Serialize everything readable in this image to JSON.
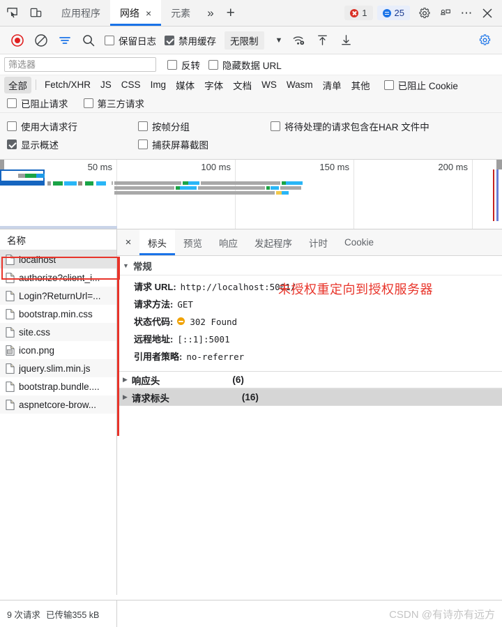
{
  "tabbar": {
    "icons": [
      {
        "name": "inspect-element-icon"
      },
      {
        "name": "device-toolbar-icon"
      }
    ],
    "tabs": [
      {
        "label": "应用程序",
        "active": false,
        "closable": false
      },
      {
        "label": "网络",
        "active": true,
        "closable": true,
        "close_label": "×"
      },
      {
        "label": "元素",
        "active": false,
        "closable": false
      }
    ],
    "more_tabs_label": "»",
    "new_tab_label": "+",
    "error_badge": "1",
    "message_badge": "25",
    "right_icons": [
      {
        "name": "settings-gear-icon"
      },
      {
        "name": "dock-position-icon"
      },
      {
        "name": "more-options-icon",
        "label": "⋯"
      },
      {
        "name": "close-devtools-icon",
        "label": "×"
      }
    ]
  },
  "net_toolbar": {
    "record_tooltip": "record",
    "clear_tooltip": "clear",
    "filter_tooltip": "filter",
    "search_tooltip": "search",
    "preserve_log_label": "保留日志",
    "preserve_log_checked": false,
    "disable_cache_label": "禁用缓存",
    "disable_cache_checked": true,
    "throttle_value": "无限制",
    "caret": "▼",
    "settings_icon": "network-settings-gear-icon"
  },
  "filter": {
    "placeholder": "筛选器",
    "value": "",
    "invert_label": "反转",
    "invert_checked": false,
    "hide_data_urls_label": "隐藏数据 URL",
    "hide_data_urls_checked": false,
    "types": [
      {
        "label": "全部",
        "active": true
      },
      {
        "label": "Fetch/XHR",
        "active": false
      },
      {
        "label": "JS",
        "active": false
      },
      {
        "label": "CSS",
        "active": false
      },
      {
        "label": "Img",
        "active": false
      },
      {
        "label": "媒体",
        "active": false
      },
      {
        "label": "字体",
        "active": false
      },
      {
        "label": "文档",
        "active": false
      },
      {
        "label": "WS",
        "active": false
      },
      {
        "label": "Wasm",
        "active": false
      },
      {
        "label": "清单",
        "active": false
      },
      {
        "label": "其他",
        "active": false
      }
    ],
    "blocked_cookies_label": "已阻止 Cookie",
    "blocked_cookies_checked": false,
    "blocked_requests_label": "已阻止请求",
    "blocked_requests_checked": false,
    "third_party_label": "第三方请求",
    "third_party_checked": false
  },
  "options": {
    "big_request_rows_label": "使用大请求行",
    "big_request_rows_checked": false,
    "group_by_frame_label": "按帧分组",
    "group_by_frame_checked": false,
    "har_pending_label": "将待处理的请求包含在HAR 文件中",
    "har_pending_checked": false,
    "show_overview_label": "显示概述",
    "show_overview_checked": true,
    "capture_screenshots_label": "捕获屏幕截图",
    "capture_screenshots_checked": false
  },
  "overview": {
    "ticks": [
      "50 ms",
      "100 ms",
      "150 ms",
      "200 ms"
    ],
    "tick_positions": [
      168,
      338,
      508,
      678
    ]
  },
  "requests": {
    "column_header": "名称",
    "items": [
      {
        "name": "localhost",
        "icon": "document-icon",
        "selected": true
      },
      {
        "name": "authorize?client_i...",
        "icon": "document-icon",
        "selected": false
      },
      {
        "name": "Login?ReturnUrl=...",
        "icon": "document-icon",
        "selected": false
      },
      {
        "name": "bootstrap.min.css",
        "icon": "document-icon",
        "selected": false
      },
      {
        "name": "site.css",
        "icon": "document-icon",
        "selected": false
      },
      {
        "name": "icon.png",
        "icon": "image-icon",
        "selected": false
      },
      {
        "name": "jquery.slim.min.js",
        "icon": "document-icon",
        "selected": false
      },
      {
        "name": "bootstrap.bundle....",
        "icon": "document-icon",
        "selected": false
      },
      {
        "name": "aspnetcore-brow...",
        "icon": "document-icon",
        "selected": false
      }
    ]
  },
  "details": {
    "close_label": "×",
    "tabs": [
      {
        "label": "标头",
        "active": true
      },
      {
        "label": "预览",
        "active": false
      },
      {
        "label": "响应",
        "active": false
      },
      {
        "label": "发起程序",
        "active": false
      },
      {
        "label": "计时",
        "active": false
      },
      {
        "label": "Cookie",
        "active": false
      }
    ],
    "general": {
      "section_label": "常规",
      "triangle": "▼",
      "rows": [
        {
          "key": "请求 URL:",
          "value": "http://localhost:5001/"
        },
        {
          "key": "请求方法:",
          "value": "GET"
        },
        {
          "key": "状态代码:",
          "value": "302 Found",
          "has_status_dot": true
        },
        {
          "key": "远程地址:",
          "value": "[::1]:5001"
        },
        {
          "key": "引用者策略:",
          "value": "no-referrer"
        }
      ]
    },
    "response_headers": {
      "label": "响应头",
      "count": "(6)",
      "triangle": "▶"
    },
    "request_headers": {
      "label": "请求标头",
      "count": "(16)",
      "triangle": "▶"
    },
    "annotation": "未授权重定向到授权服务器"
  },
  "statusbar": {
    "requests_text": "9 次请求",
    "transferred_text": "已传输355 kB",
    "watermark": "CSDN @有诗亦有远方"
  },
  "colors": {
    "accent": "#1a73e8",
    "error": "#d93025",
    "annotation": "#e8342a",
    "status_302": "#f0a202",
    "selection_box": "#1565c0"
  }
}
